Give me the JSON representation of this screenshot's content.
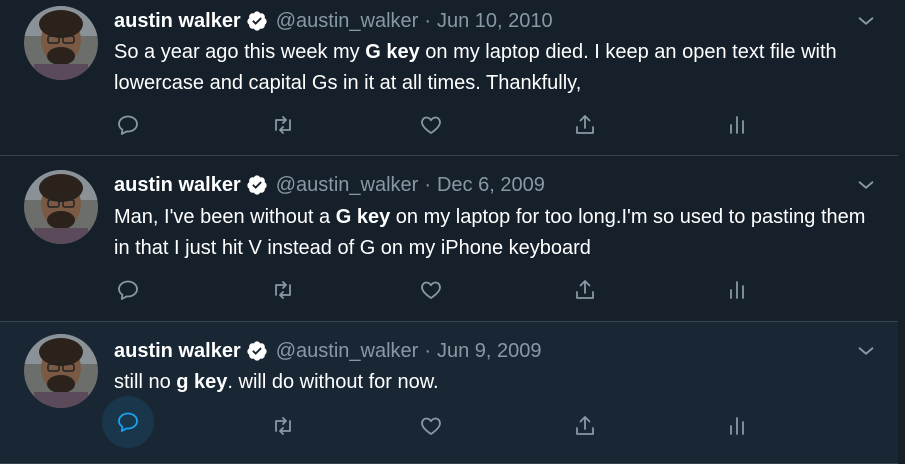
{
  "tweets": [
    {
      "display_name": "austin walker",
      "handle": "@austin_walker",
      "separator": "·",
      "date": "Jun 10, 2010",
      "text_parts": [
        "So a year ago this week my ",
        "G key",
        " on my laptop died. I keep an open text file with lowercase and capital Gs in it at all times. Thankfully,"
      ]
    },
    {
      "display_name": "austin walker",
      "handle": "@austin_walker",
      "separator": "·",
      "date": "Dec 6, 2009",
      "text_parts": [
        "Man, I've been without a ",
        "G key",
        " on my laptop for too long.I'm so used to pasting them in that I just hit V instead of G on my iPhone keyboard"
      ]
    },
    {
      "display_name": "austin walker",
      "handle": "@austin_walker",
      "separator": "·",
      "date": "Jun 9, 2009",
      "text_parts": [
        "still no ",
        "g key",
        ". will do without for now."
      ]
    }
  ],
  "icons": {
    "reply": "reply-icon",
    "retweet": "retweet-icon",
    "like": "heart-icon",
    "share": "share-icon",
    "analytics": "analytics-icon",
    "more": "chevron-down-icon",
    "verified": "verified-badge-icon"
  },
  "colors": {
    "background": "#15202b",
    "hover_background": "#192734",
    "border": "#38444d",
    "secondary_text": "#8899a6",
    "accent": "#1da1f2"
  }
}
